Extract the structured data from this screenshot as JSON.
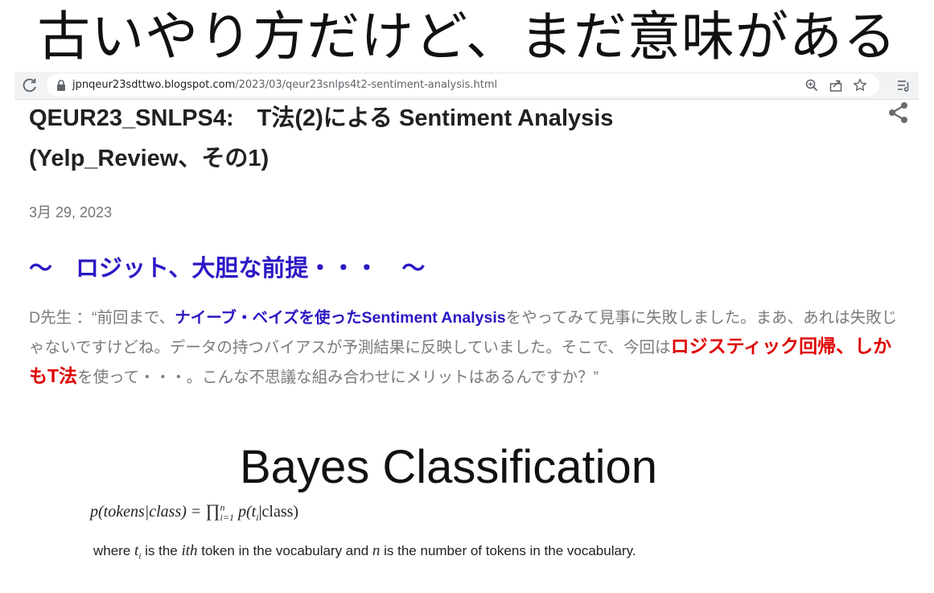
{
  "headline": "古いやり方だけど、まだ意味がある",
  "browser": {
    "url_host": "jpnqeur23sdttwo.blogspot.com",
    "url_path": "/2023/03/qeur23snlps4t2-sentiment-analysis.html",
    "icons": [
      "reload-icon",
      "lock-icon",
      "zoom-icon",
      "share-page-icon",
      "bookmark-star-icon",
      "reading-list-icon"
    ]
  },
  "post": {
    "title_line1": "QEUR23_SNLPS4:　T法(2)による Sentiment Analysis",
    "title_line2": "(Yelp_Review、その1)",
    "date": "3月 29, 2023",
    "subheading": "～　ロジット、大胆な前提・・・　～",
    "paragraph": {
      "p1": "D先生 ：“前回まで、",
      "p2": "ナイーブ・ベイズを使ったSentiment Analysis",
      "p3": "をやってみて見事に失敗しました。まあ、あれは失敗じゃないですけどね。データの持つバイアスが予測結果に反映していました。そこで、今回は",
      "p4": "ロジスティック回帰、しかもT法",
      "p5": "を使って・・・。こんな不思議な組み合わせにメリットはあるんですか？”"
    }
  },
  "slide": {
    "title": "Bayes Classification",
    "formula": {
      "lhs": "p(tokens|class) = ",
      "prod": "∏",
      "sup": "n",
      "sub": "i=1",
      "rhs": "p(t",
      "rhs_sub": "i",
      "rhs_end": "|class)"
    },
    "where": {
      "w1": "where ",
      "t": "t",
      "ti": "i",
      "w2": " is the ",
      "ith": "ith",
      "w3": " token in the vocabulary and ",
      "n": "n",
      "w4": " is the number of tokens in the vocabulary."
    }
  },
  "colors": {
    "accent_blue": "#2a18c4",
    "highlight_red": "#e00000",
    "body_gray": "#7b7b7b"
  }
}
